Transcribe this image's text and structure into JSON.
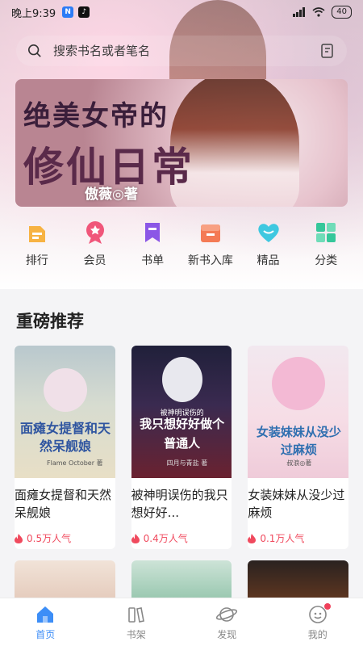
{
  "status_bar": {
    "time": "晚上9:39",
    "battery": "40"
  },
  "search": {
    "placeholder": "搜索书名或者笔名"
  },
  "banner": {
    "title_line1": "绝美女帝的",
    "title_line2": "修仙日常",
    "author": "傲薇◎著",
    "slides": 4,
    "active_slide": 1
  },
  "nav_items": [
    {
      "label": "排行",
      "icon": "ranking-icon",
      "color": "#f7b343"
    },
    {
      "label": "会员",
      "icon": "vip-icon",
      "color": "#f0567a"
    },
    {
      "label": "书单",
      "icon": "booklist-icon",
      "color": "#8b57e6"
    },
    {
      "label": "新书入库",
      "icon": "new-books-icon",
      "color": "#f47a55"
    },
    {
      "label": "精品",
      "icon": "heart-icon",
      "color": "#3ec8e0"
    },
    {
      "label": "分类",
      "icon": "category-icon",
      "color": "#35c79a"
    }
  ],
  "section": {
    "title": "重磅推荐"
  },
  "books": [
    {
      "title": "面瘫女提督和天然呆舰娘",
      "cover_title": "面瘫女提督和天然呆舰娘",
      "cover_author": "Flame October 著",
      "popularity": "0.5万人气"
    },
    {
      "title": "被神明误伤的我只想好好...",
      "cover_sub": "被神明误伤的",
      "cover_title": "我只想好好做个普通人",
      "cover_author": "四月与青盐 著",
      "popularity": "0.4万人气"
    },
    {
      "title": "女装妹妹从没少过麻烦",
      "cover_title": "女装妹妹从没少过麻烦",
      "cover_author": "叔浪◎著",
      "popularity": "0.1万人气"
    }
  ],
  "tabs": [
    {
      "label": "首页",
      "icon": "home-icon",
      "active": true
    },
    {
      "label": "书架",
      "icon": "bookshelf-icon",
      "active": false
    },
    {
      "label": "发现",
      "icon": "discover-planet-icon",
      "active": false
    },
    {
      "label": "我的",
      "icon": "profile-icon",
      "active": false,
      "badge": true
    }
  ],
  "colors": {
    "accent": "#3d8ef7",
    "popularity": "#f04a5e"
  }
}
